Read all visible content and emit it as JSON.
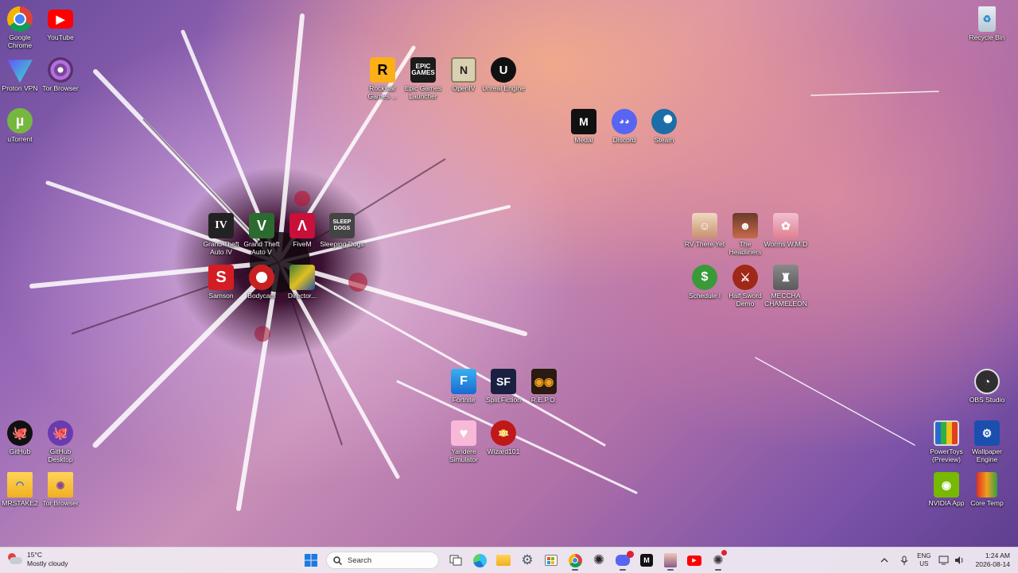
{
  "desktop": {
    "icons": {
      "google_chrome": "Google Chrome",
      "youtube": "YouTube",
      "proton_vpn": "Proton VPN",
      "tor_browser": "Tor Browser",
      "utorrent": "uTorrent",
      "rockstar": "Rockstar Games ...",
      "epic": "Epic Games Launcher",
      "openiv": "OpenIV",
      "unreal": "Unreal Engine",
      "medal": "Medal",
      "discord": "Discord",
      "steam": "Steam",
      "recycle_bin": "Recycle Bin",
      "gta4": "Grand Theft Auto IV",
      "gta5": "Grand Theft Auto V",
      "fivem": "FiveM",
      "sleeping_dogs": "Sleeping Dogs",
      "samson": "Samson",
      "bodycam": "Bodycam",
      "director": "Director...",
      "rv_there_yet": "RV There Yet",
      "headliners": "The Headliners",
      "worms": "Worms W.M.D",
      "schedule1": "Schedule I",
      "half_sword": "Half Sword Demo",
      "meccha": "MECCHA CHAMELEON",
      "fortnite": "Fortnite",
      "split_fiction": "Split Fiction",
      "repo": "R.E.P.O.",
      "yandere": "Yandere Simulator",
      "wizard101": "Wizard101",
      "obs": "OBS Studio",
      "github": "GitHub",
      "github_desktop": "GitHub Desktop",
      "powertoys": "PowerToys (Preview)",
      "wallpaper_engine": "Wallpaper Engine",
      "mrstake2": "MRSTAKE2",
      "tor_browser_folder": "Tor Browser",
      "nvidia": "NVIDIA App",
      "core_temp": "Core Temp"
    }
  },
  "taskbar": {
    "weather_temp": "15°C",
    "weather_desc": "Mostly cloudy",
    "search_label": "Search",
    "lang_top": "ENG",
    "lang_bottom": "US",
    "time": "1:24 AM",
    "date": "2026-08-14"
  },
  "colors": {
    "taskbar_bg": "#eee8f0",
    "windows_blue": "#1a7be0"
  }
}
